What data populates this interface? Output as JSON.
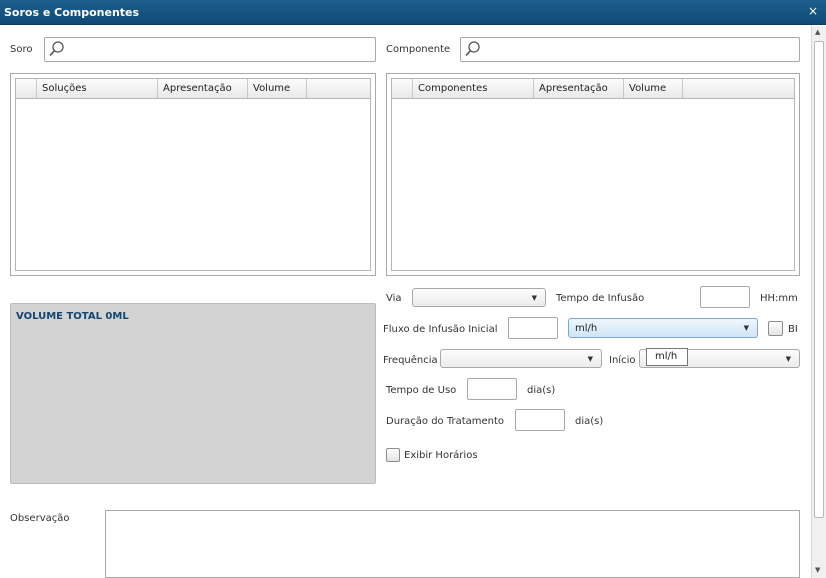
{
  "window": {
    "title": "Soros e Componentes",
    "close_glyph": "×"
  },
  "soro": {
    "label": "Soro",
    "value": ""
  },
  "componente": {
    "label": "Componente",
    "value": ""
  },
  "solucoes_grid": {
    "columns": [
      "Soluções",
      "Apresentação",
      "Volume"
    ]
  },
  "componentes_grid": {
    "columns": [
      "Componentes",
      "Apresentação",
      "Volume"
    ]
  },
  "volume_total": "VOLUME TOTAL 0ML",
  "via": {
    "label": "Via",
    "selected": ""
  },
  "tempo_infusao": {
    "label": "Tempo de Infusão",
    "value": "",
    "unit": "HH:mm"
  },
  "fluxo": {
    "label": "Fluxo de Infusão Inicial",
    "value": "",
    "unit_selected": "ml/h",
    "bi_label": "BI"
  },
  "frequencia": {
    "label": "Frequência",
    "selected": ""
  },
  "inicio": {
    "label": "Início",
    "selected": ""
  },
  "tooltip": "ml/h",
  "tempo_uso": {
    "label": "Tempo de Uso",
    "value": "",
    "unit": "dia(s)"
  },
  "duracao": {
    "label": "Duração do Tratamento",
    "value": "",
    "unit": "dia(s)"
  },
  "exibir_horarios": {
    "label": "Exibir Horários",
    "checked": false
  },
  "observacao": {
    "label": "Observação",
    "value": ""
  },
  "icons": {
    "search": "search-icon",
    "dropdown": "chevron-down-icon",
    "close": "close-icon"
  }
}
